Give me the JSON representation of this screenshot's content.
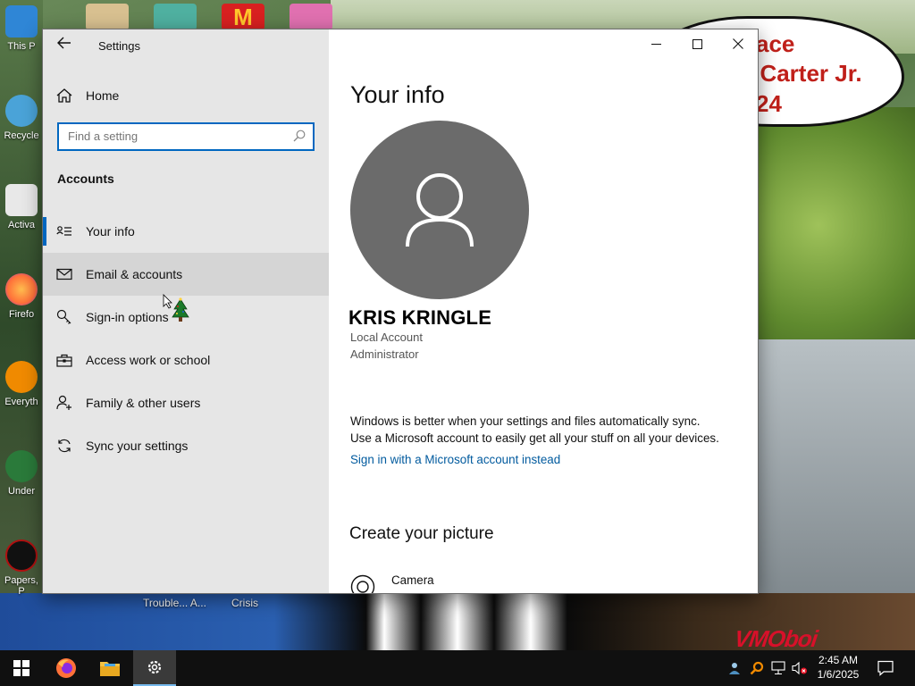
{
  "desktop": {
    "icons": [
      {
        "label": "This P",
        "color": "#2f86d6"
      },
      {
        "label": "Recycle",
        "color": "#4aa3d8"
      },
      {
        "label": "Activa",
        "color": "#e0e0e0"
      },
      {
        "label": "Firefo",
        "color": "#ff7139"
      },
      {
        "label": "Everyth",
        "color": "#f08a00"
      },
      {
        "label": "Under",
        "color": "#2a7a3a"
      },
      {
        "label": "Papers, P",
        "color": "#111111"
      }
    ],
    "bottom_labels": [
      "Trouble... A...",
      "Crisis"
    ],
    "speech_lines": [
      "ace",
      "l Carter Jr.",
      "24"
    ],
    "watermark": "VMOboi"
  },
  "window": {
    "app_title": "Settings",
    "controls": {
      "minimize": "—",
      "maximize": "☐",
      "close": "✕"
    }
  },
  "sidebar": {
    "home_label": "Home",
    "search_placeholder": "Find a setting",
    "section_title": "Accounts",
    "items": [
      {
        "label": "Your info",
        "icon": "person-card-icon"
      },
      {
        "label": "Email & accounts",
        "icon": "mail-icon"
      },
      {
        "label": "Sign-in options",
        "icon": "key-icon"
      },
      {
        "label": "Access work or school",
        "icon": "briefcase-icon"
      },
      {
        "label": "Family & other users",
        "icon": "person-add-icon"
      },
      {
        "label": "Sync your settings",
        "icon": "sync-icon"
      }
    ]
  },
  "main": {
    "title": "Your info",
    "user_name": "KRIS KRINGLE",
    "account_type": "Local Account",
    "role": "Administrator",
    "sync_line1": "Windows is better when your settings and files automatically sync.",
    "sync_line2": "Use a Microsoft account to easily get all your stuff on all your devices.",
    "signin_link": "Sign in with a Microsoft account instead",
    "picture_heading": "Create your picture",
    "camera_label": "Camera"
  },
  "taskbar": {
    "time": "2:45 AM",
    "date": "1/6/2025",
    "accent": "#76b9ed"
  }
}
